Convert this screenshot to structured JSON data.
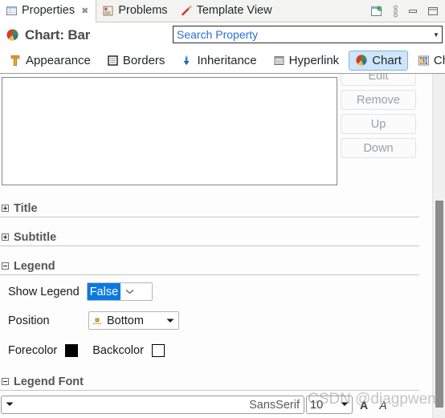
{
  "view_tabs": [
    {
      "label": "Properties",
      "icon": "properties-grid-icon",
      "active": true,
      "closable": true
    },
    {
      "label": "Problems",
      "icon": "problems-icon",
      "active": false,
      "closable": false
    },
    {
      "label": "Template View",
      "icon": "pencil-icon",
      "active": false,
      "closable": false
    }
  ],
  "view_bar_actions": [
    {
      "name": "new-window-icon",
      "label": ""
    },
    {
      "name": "view-menu-icon",
      "label": ""
    },
    {
      "name": "minimize-icon",
      "label": ""
    },
    {
      "name": "maximize-icon",
      "label": ""
    }
  ],
  "header": {
    "title": "Chart: Bar",
    "title_icon": "pie-chart-icon"
  },
  "search": {
    "value": "Search Property",
    "placeholder": "Search Property",
    "dropdown_icon": "chevron-down-icon"
  },
  "property_tabs": [
    {
      "label": "Appearance",
      "icon": "ruler-icon",
      "selected": false
    },
    {
      "label": "Borders",
      "icon": "borders-icon",
      "selected": false
    },
    {
      "label": "Inheritance",
      "icon": "inheritance-arrow-icon",
      "selected": false
    },
    {
      "label": "Hyperlink",
      "icon": "hyperlink-icon",
      "selected": false
    },
    {
      "label": "Chart",
      "icon": "pie-chart-icon",
      "selected": true
    },
    {
      "label": "Chart",
      "icon": "chart-palette-icon",
      "selected": false
    }
  ],
  "list_buttons": [
    {
      "label": "Edit",
      "enabled": false
    },
    {
      "label": "Remove",
      "enabled": false
    },
    {
      "label": "Up",
      "enabled": false
    },
    {
      "label": "Down",
      "enabled": false
    }
  ],
  "sections": [
    {
      "title": "Title",
      "expanded": false
    },
    {
      "title": "Subtitle",
      "expanded": false
    },
    {
      "title": "Legend",
      "expanded": true
    },
    {
      "title": "Legend Font",
      "expanded": true
    }
  ],
  "legend": {
    "show_legend": {
      "label": "Show Legend",
      "value": "False",
      "dropdown_icon": "chevron-down-icon"
    },
    "position": {
      "label": "Position",
      "value": "Bottom",
      "value_icon": "legend-bottom-icon",
      "dropdown_icon": "chevron-down-solid-icon"
    },
    "forecolor": {
      "label": "Forecolor",
      "color": "#000000"
    },
    "backcolor": {
      "label": "Backcolor",
      "color": "#ffffff"
    }
  },
  "legend_font": {
    "family": "SansSerif",
    "family_arrow_icon": "chevron-down-solid-icon",
    "size": "10",
    "size_arrow_icon": "chevron-down-solid-icon",
    "buttons": [
      {
        "name": "bold-button",
        "label": "A"
      },
      {
        "name": "italic-button",
        "label": "A"
      }
    ]
  },
  "scrollbar": {
    "name": "vertical-scrollbar",
    "orientation": "vertical"
  },
  "watermark": {
    "text": "CSDN @diagpwen"
  },
  "colors": {
    "selection_blue": "#0a7ae0",
    "tab_selected_bg": "#cfe6fa",
    "search_text": "#2a6fd4",
    "section_title": "#565656"
  }
}
